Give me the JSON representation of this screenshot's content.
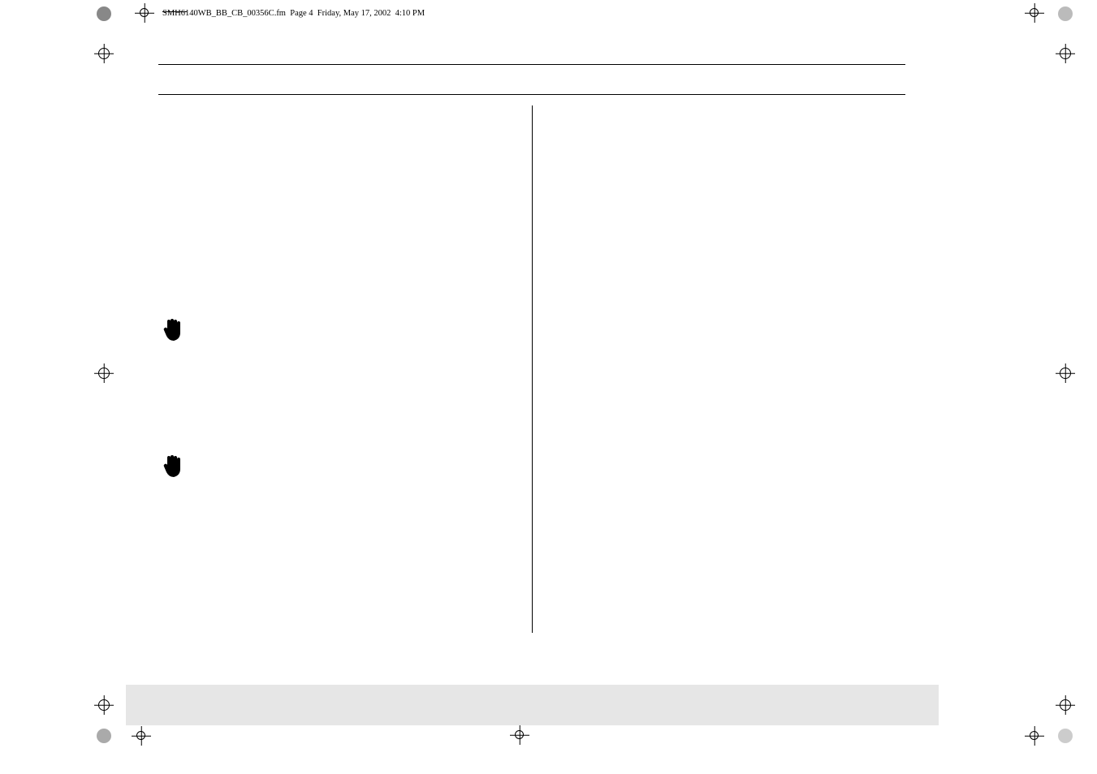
{
  "doc_header": {
    "filename": "SMH6140WB_BB_CB_00356C.fm",
    "page_label": "Page 4",
    "date": "Friday, May 17, 2002",
    "time": "4:10 PM"
  },
  "marks": {
    "cmyk": [
      "black",
      "cyan",
      "magenta",
      "yellow"
    ]
  },
  "icons": {
    "hand": "hand-stop-icon"
  }
}
